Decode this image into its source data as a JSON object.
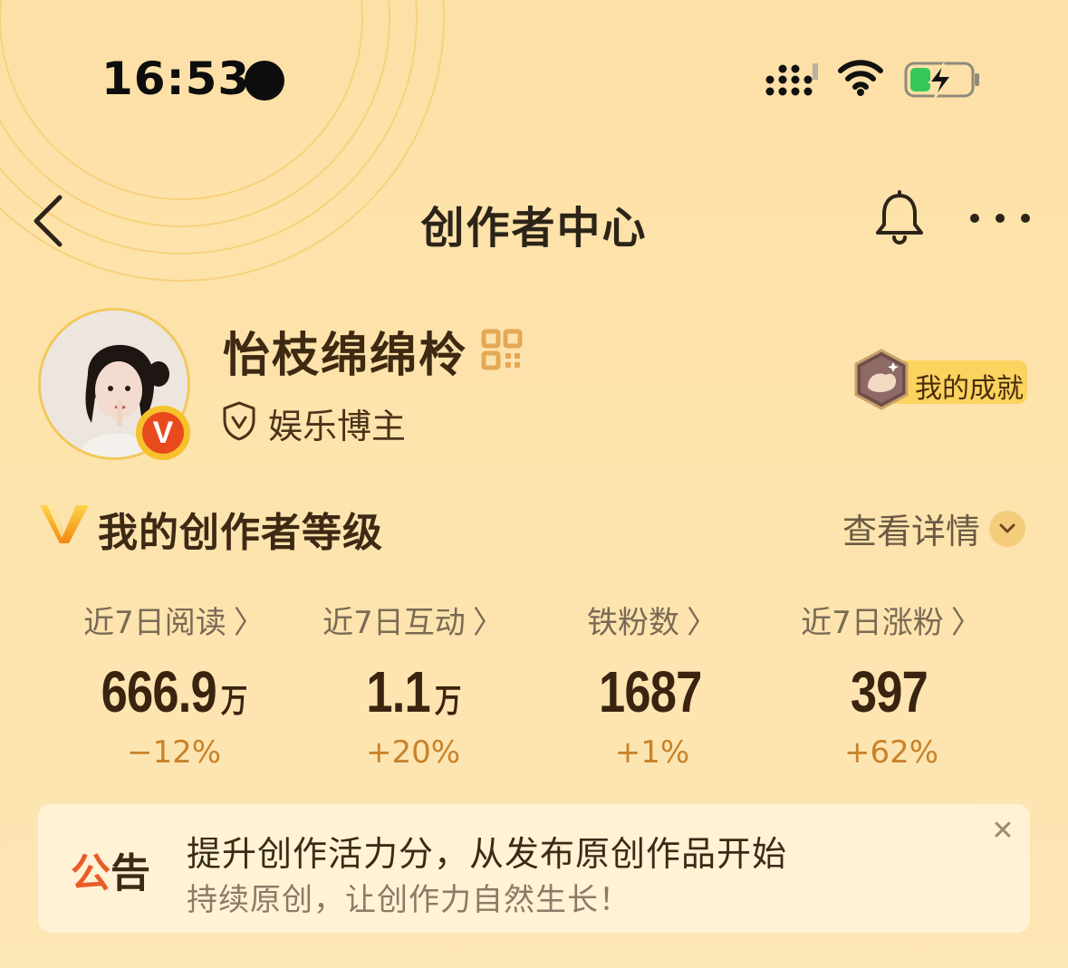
{
  "status_bar": {
    "time": "16:53",
    "icons": [
      "signal-icon",
      "wifi-icon",
      "battery-charging-icon"
    ]
  },
  "nav": {
    "title": "创作者中心",
    "icons": [
      "back-chevron-icon",
      "bell-icon",
      "more-dots-icon"
    ]
  },
  "profile": {
    "username": "怡枝绵绵柃",
    "role": "娱乐博主",
    "verified_badge": "V",
    "achievements_label": "我的成就"
  },
  "level": {
    "title": "我的创作者等级",
    "details_label": "查看详情"
  },
  "stats": [
    {
      "label": "近7日阅读",
      "value": "666.9",
      "unit": "万",
      "change": "−12%"
    },
    {
      "label": "近7日互动",
      "value": "1.1",
      "unit": "万",
      "change": "+20%"
    },
    {
      "label": "铁粉数",
      "value": "1687",
      "unit": "",
      "change": "+1%"
    },
    {
      "label": "近7日涨粉",
      "value": "397",
      "unit": "",
      "change": "+62%"
    }
  ],
  "notice": {
    "tag_part1": "公",
    "tag_part2": "告",
    "line1": "提升创作活力分，从发布原创作品开始",
    "line2": "持续原创，让创作力自然生长！",
    "close": "✕"
  },
  "colors": {
    "background": "#fde0a6",
    "accent_orange": "#ea5b2a",
    "change_text": "#c9822a",
    "badge_yellow": "#fbd35f"
  }
}
